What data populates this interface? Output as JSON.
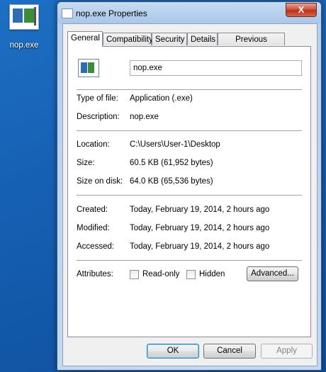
{
  "desktop": {
    "icon_label": "nop.exe"
  },
  "window": {
    "title": "nop.exe Properties",
    "close_glyph": "X"
  },
  "tabs": [
    {
      "label": "General",
      "active": true
    },
    {
      "label": "Compatibility",
      "active": false
    },
    {
      "label": "Security",
      "active": false
    },
    {
      "label": "Details",
      "active": false
    },
    {
      "label": "Previous Versions",
      "active": false
    }
  ],
  "general": {
    "file_name_value": "nop.exe",
    "type_of_file": {
      "label": "Type of file:",
      "value": "Application (.exe)"
    },
    "description": {
      "label": "Description:",
      "value": "nop.exe"
    },
    "location": {
      "label": "Location:",
      "value": "C:\\Users\\User-1\\Desktop"
    },
    "size": {
      "label": "Size:",
      "value": "60.5 KB (61,952 bytes)"
    },
    "size_on_disk": {
      "label": "Size on disk:",
      "value": "64.0 KB (65,536 bytes)"
    },
    "created": {
      "label": "Created:",
      "value": "Today, February 19, 2014, 2 hours ago"
    },
    "modified": {
      "label": "Modified:",
      "value": "Today, February 19, 2014, 2 hours ago"
    },
    "accessed": {
      "label": "Accessed:",
      "value": "Today, February 19, 2014, 2 hours ago"
    },
    "attributes": {
      "label": "Attributes:",
      "readonly_label": "Read-only",
      "readonly_checked": false,
      "hidden_label": "Hidden",
      "hidden_checked": false,
      "advanced_label": "Advanced..."
    }
  },
  "buttons": {
    "ok": "OK",
    "cancel": "Cancel",
    "apply": "Apply"
  },
  "colors": {
    "desktop": "#1660b3",
    "close_button": "#c8432b",
    "default_button_border": "#3c7fb1"
  }
}
